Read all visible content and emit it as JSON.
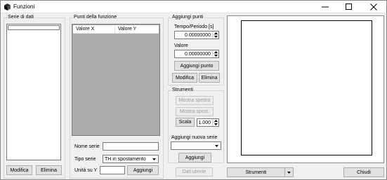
{
  "window": {
    "title": "Funzioni"
  },
  "series_panel": {
    "title": "Serie di dati",
    "modify_label": "Modifica",
    "delete_label": "Elimina"
  },
  "function_points": {
    "title": "Punti della funzione",
    "columns": [
      "Valore X",
      "Valore Y"
    ],
    "series_name_label": "Nome serie",
    "series_name_value": "",
    "series_type_label": "Tipo serie",
    "series_type_selected": "TH in spostamento",
    "y_unit_label": "Unità su Y",
    "y_unit_value": "",
    "add_label": "Aggiungi"
  },
  "add_points": {
    "title": "Aggiungi punti",
    "time_label": "Tempo/Periodo [s]",
    "time_value": "0.00000000",
    "value_label": "Valore",
    "value_value": "0.00000000",
    "add_point_label": "Aggiungi punto",
    "modify_label": "Modifica",
    "delete_label": "Elimina"
  },
  "tools": {
    "title": "Strumenti",
    "show_spectrum_label": "Mostra spettro",
    "show_displacement_label": "Mostra spost.",
    "scale_label": "Scala",
    "scale_value": "1.000",
    "add_series_label": "Aggiungi nuova serie",
    "add_series_value": "",
    "add_label": "Aggiungi"
  },
  "footer": {
    "user_data_label": "Dati utente",
    "tools_label": "Strumenti",
    "close_label": "Chiudi"
  }
}
